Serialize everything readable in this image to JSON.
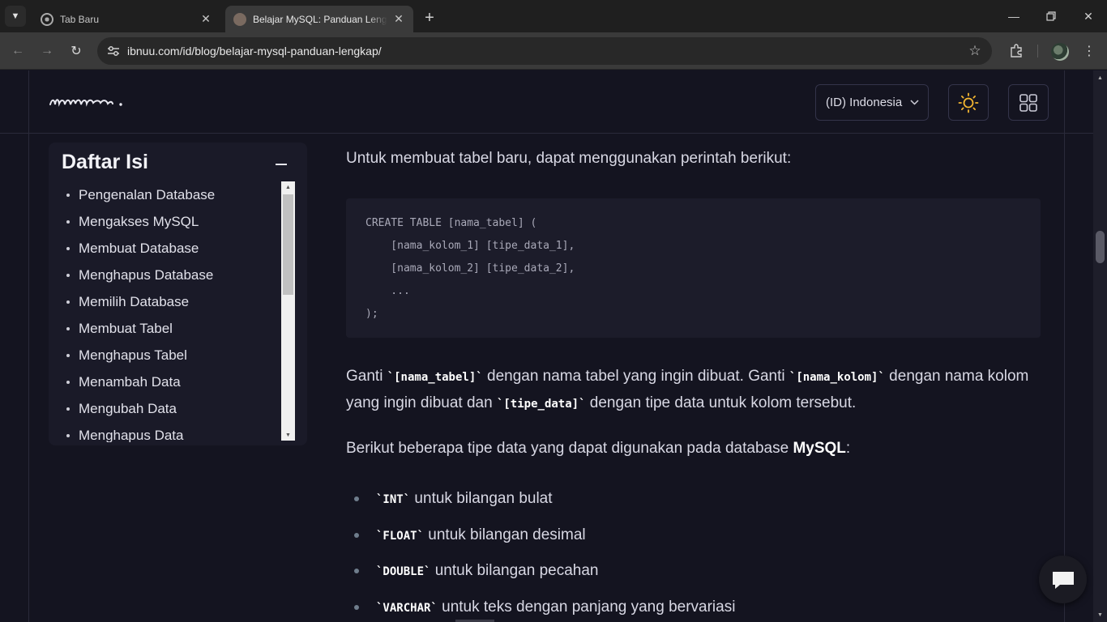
{
  "browser": {
    "tabs": [
      {
        "title": "Tab Baru"
      },
      {
        "title": "Belajar MySQL: Panduan Lengkap"
      }
    ],
    "url": "ibnuu.com/id/blog/belajar-mysql-panduan-lengkap/"
  },
  "header": {
    "language": "(ID) Indonesia",
    "accent_color": "#f5b731"
  },
  "toc": {
    "title": "Daftar Isi",
    "items": [
      "Pengenalan Database",
      "Mengakses MySQL",
      "Membuat Database",
      "Menghapus Database",
      "Memilih Database",
      "Membuat Tabel",
      "Menghapus Tabel",
      "Menambah Data",
      "Mengubah Data",
      "Menghapus Data"
    ]
  },
  "article": {
    "intro": "Untuk membuat tabel baru, dapat menggunakan perintah berikut:",
    "code": "CREATE TABLE [nama_tabel] (\n    [nama_kolom_1] [tipe_data_1],\n    [nama_kolom_2] [tipe_data_2],\n    ...\n);",
    "ganti": {
      "t1": "Ganti ",
      "c1": "`[nama_tabel]`",
      "t2": " dengan nama tabel yang ingin dibuat. Ganti ",
      "c2": "`[nama_kolom]`",
      "t3": " dengan nama kolom yang ingin dibuat dan ",
      "c3": "`[tipe_data]`",
      "t4": " dengan tipe data untuk kolom tersebut."
    },
    "berikut": {
      "t1": "Berikut beberapa tipe data yang dapat digunakan pada database ",
      "strong": "MySQL",
      "t2": ":"
    },
    "types": [
      {
        "code": "`INT`",
        "text": " untuk bilangan bulat"
      },
      {
        "code": "`FLOAT`",
        "text": " untuk bilangan desimal"
      },
      {
        "code": "`DOUBLE`",
        "text": " untuk bilangan pecahan"
      },
      {
        "code": "`VARCHAR`",
        "text": " untuk teks dengan panjang yang bervariasi"
      }
    ]
  }
}
